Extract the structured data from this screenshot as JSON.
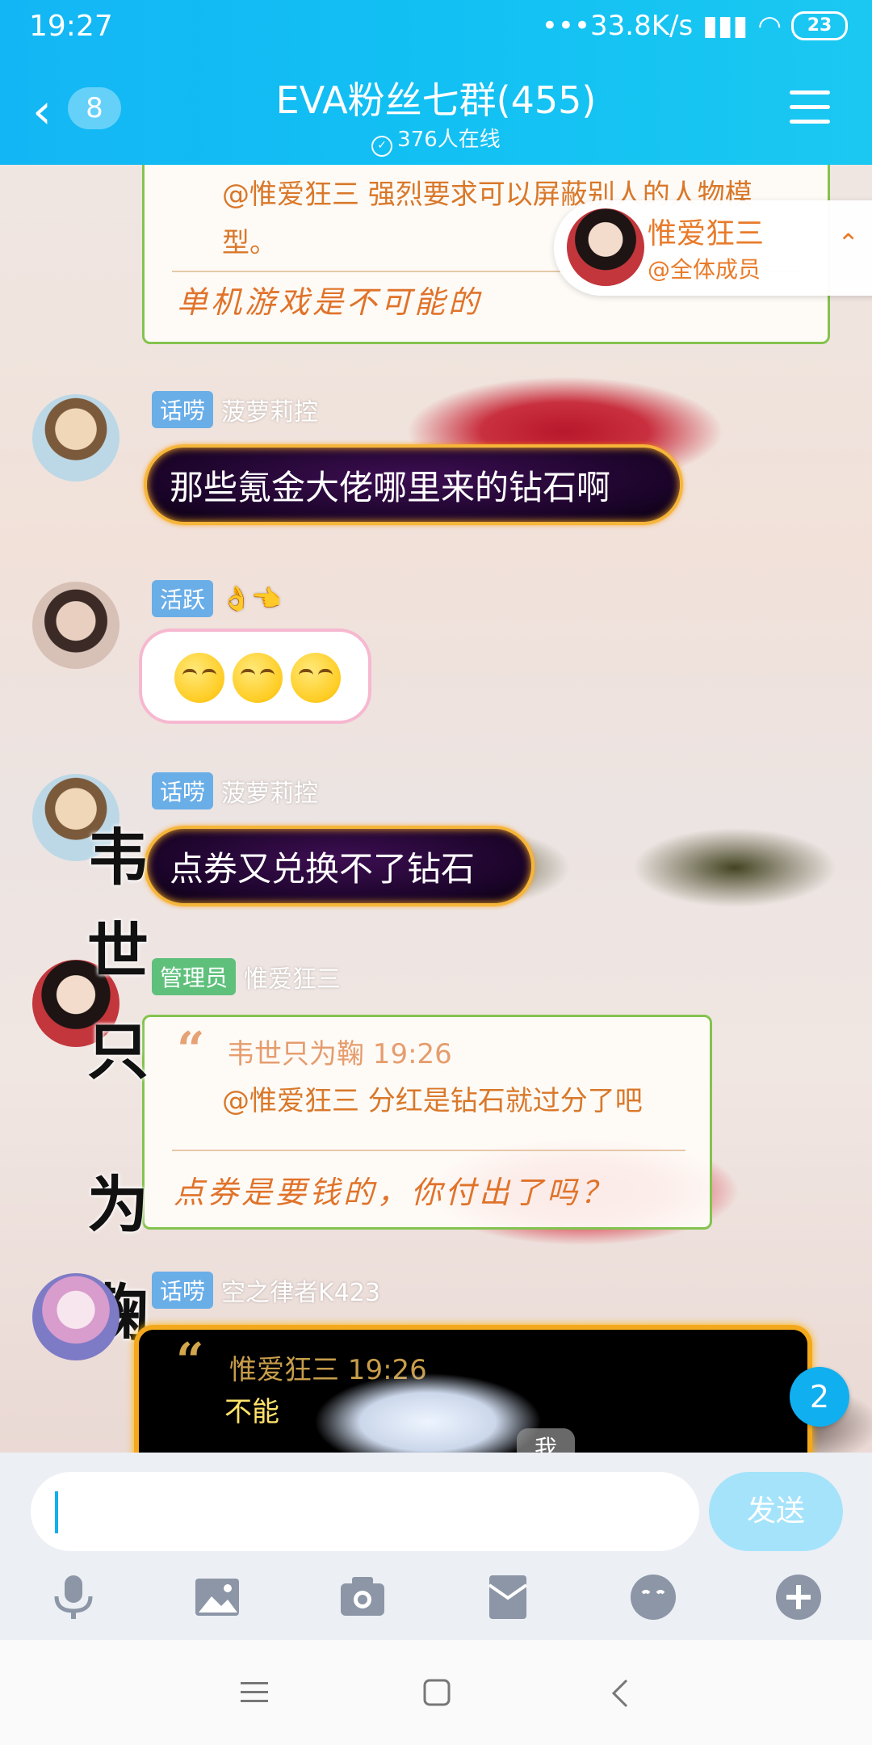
{
  "status_bar": {
    "time": "19:27",
    "network": "•••33.8K/s",
    "battery": "23"
  },
  "header": {
    "unread_count": "8",
    "title": "EVA粉丝七群(455)",
    "online": "376人在线"
  },
  "mention": {
    "name": "惟爱狂三",
    "sub": "@全体成员"
  },
  "messages": {
    "m0": {
      "body": "@惟爱狂三 强烈要求可以屏蔽别人的人物模型。",
      "reply": "单机游戏是不可能的"
    },
    "m1": {
      "tag": "话唠",
      "nick": "菠萝莉控",
      "text": "那些氪金大佬哪里来的钻石啊"
    },
    "m2": {
      "tag": "活跃",
      "nick": "👌👈"
    },
    "m3": {
      "tag": "话唠",
      "nick": "菠萝莉控",
      "text": "点券又兑换不了钻石"
    },
    "m4": {
      "tag": "管理员",
      "nick": "惟爱狂三",
      "quote_name": "韦世只为鞠 19:26",
      "quote_body": "@惟爱狂三 分红是钻石就过分了吧",
      "reply": "点券是要钱的，你付出了吗？"
    },
    "m5": {
      "tag": "话唠",
      "nick": "空之律者K423",
      "quote_name": "惟爱狂三 19:26",
      "quote_body": "不能"
    }
  },
  "side_text": [
    "韦",
    "世",
    "只",
    "为",
    "鞠"
  ],
  "floating": {
    "new_count": "2",
    "me_label": "我"
  },
  "input": {
    "placeholder": "",
    "send_label": "发送"
  },
  "colors": {
    "accent": "#10aff0",
    "header": "#13b6f4"
  }
}
